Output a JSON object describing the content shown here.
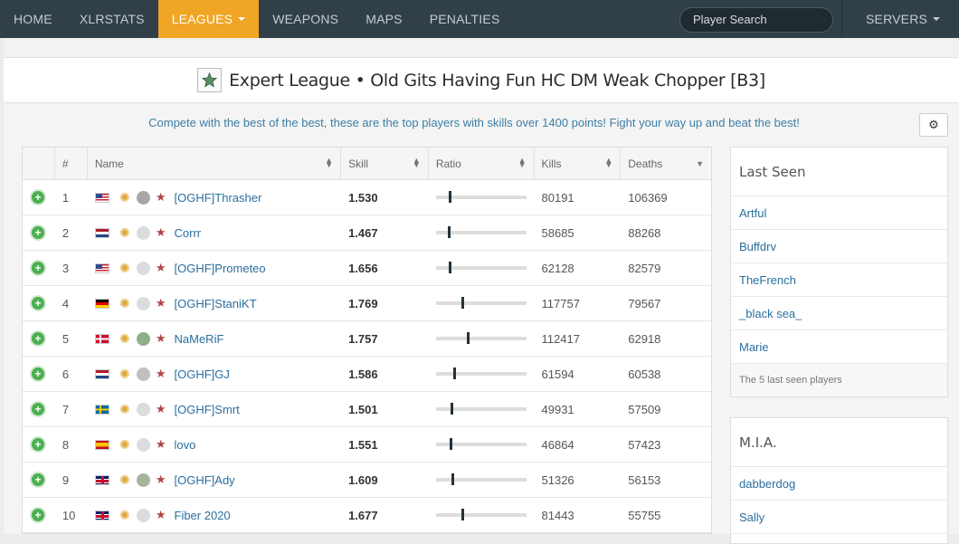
{
  "nav": {
    "items": [
      "HOME",
      "XLRSTATS",
      "LEAGUES",
      "WEAPONS",
      "MAPS",
      "PENALTIES"
    ],
    "active": "LEAGUES",
    "search_placeholder": "Player Search",
    "servers_label": "SERVERS"
  },
  "colors": {
    "navbar": "#303f48",
    "active_tab": "#f0a524",
    "link": "#2a6f9e",
    "add_button": "#4caf50"
  },
  "page": {
    "title": "Expert League • Old Gits Having Fun HC DM Weak Chopper [B3]",
    "tagline": "Compete with the best of the best, these are the top players with skills over 1400 points! Fight your way up and beat the best!",
    "settings_icon": "gear-icon"
  },
  "table": {
    "headers": [
      "#",
      "Name",
      "Skill",
      "Ratio",
      "Kills",
      "Deaths"
    ],
    "rows": [
      {
        "rank": "1",
        "flag": "us",
        "name": "[OGHF]Thrasher",
        "skill": "1.530",
        "ratio": 0.14,
        "kills": "80191",
        "deaths": "106369",
        "pie": "#a7a7a7"
      },
      {
        "rank": "2",
        "flag": "nl",
        "name": "Corrr",
        "skill": "1.467",
        "ratio": 0.13,
        "kills": "58685",
        "deaths": "88268",
        "pie": "#dcdcdc"
      },
      {
        "rank": "3",
        "flag": "us",
        "name": "[OGHF]Prometeo",
        "skill": "1.656",
        "ratio": 0.14,
        "kills": "62128",
        "deaths": "82579",
        "pie": "#dcdcdc"
      },
      {
        "rank": "4",
        "flag": "de",
        "name": "[OGHF]StaniKT",
        "skill": "1.769",
        "ratio": 0.28,
        "kills": "117757",
        "deaths": "79567",
        "pie": "#dcdcdc"
      },
      {
        "rank": "5",
        "flag": "dk",
        "name": "NaMeRiF",
        "skill": "1.757",
        "ratio": 0.34,
        "kills": "112417",
        "deaths": "62918",
        "pie": "#8fae8a"
      },
      {
        "rank": "6",
        "flag": "nl",
        "name": "[OGHF]GJ",
        "skill": "1.586",
        "ratio": 0.19,
        "kills": "61594",
        "deaths": "60538",
        "pie": "#c0c0c0"
      },
      {
        "rank": "7",
        "flag": "se",
        "name": "[OGHF]Smrt",
        "skill": "1.501",
        "ratio": 0.16,
        "kills": "49931",
        "deaths": "57509",
        "pie": "#dcdcdc"
      },
      {
        "rank": "8",
        "flag": "es",
        "name": "lovo",
        "skill": "1.551",
        "ratio": 0.15,
        "kills": "46864",
        "deaths": "57423",
        "pie": "#dcdcdc"
      },
      {
        "rank": "9",
        "flag": "gb",
        "name": "[OGHF]Ady",
        "skill": "1.609",
        "ratio": 0.17,
        "kills": "51326",
        "deaths": "56153",
        "pie": "#a7b59f"
      },
      {
        "rank": "10",
        "flag": "gb",
        "name": "Fiber 2020",
        "skill": "1.677",
        "ratio": 0.28,
        "kills": "81443",
        "deaths": "55755",
        "pie": "#dcdcdc"
      }
    ]
  },
  "last_seen": {
    "title": "Last Seen",
    "players": [
      "Artful",
      "Buffdrv",
      "TheFrench",
      "_black sea_",
      "Marie"
    ],
    "footer": "The 5 last seen players"
  },
  "mia": {
    "title": "M.I.A.",
    "players": [
      "dabberdog",
      "Sally"
    ]
  }
}
